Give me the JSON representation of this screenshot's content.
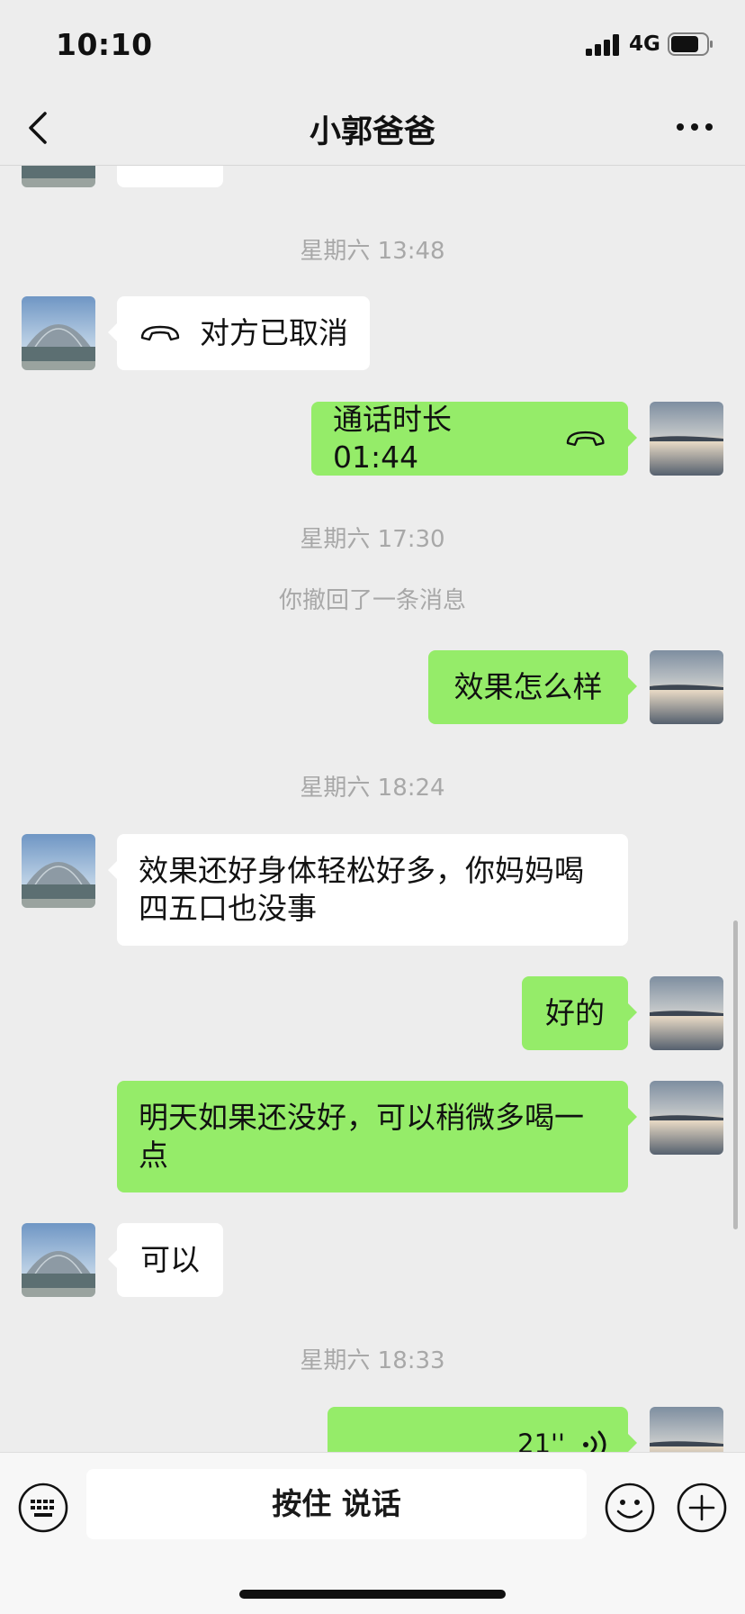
{
  "status_bar": {
    "time": "10:10",
    "network": "4G"
  },
  "header": {
    "title": "小郭爸爸"
  },
  "messages": [
    {
      "kind": "timestamp",
      "text": "星期六 13:48"
    },
    {
      "kind": "call",
      "side": "left",
      "text": "对方已取消"
    },
    {
      "kind": "call",
      "side": "right",
      "text": "通话时长 01:44"
    },
    {
      "kind": "timestamp",
      "text": "星期六 17:30"
    },
    {
      "kind": "system",
      "text": "你撤回了一条消息"
    },
    {
      "kind": "text",
      "side": "right",
      "text": "效果怎么样"
    },
    {
      "kind": "timestamp",
      "text": "星期六 18:24"
    },
    {
      "kind": "text",
      "side": "left",
      "lines": [
        "效果还好身体轻松好多，你妈妈喝",
        "四五口也没事"
      ]
    },
    {
      "kind": "text",
      "side": "right",
      "text": "好的"
    },
    {
      "kind": "text",
      "side": "right",
      "lines": [
        "明天如果还没好，可以稍微多喝一",
        "点"
      ]
    },
    {
      "kind": "text",
      "side": "left",
      "text": "可以"
    },
    {
      "kind": "timestamp",
      "text": "星期六 18:33"
    },
    {
      "kind": "voice",
      "side": "right",
      "duration": "21''"
    }
  ],
  "input_bar": {
    "hold_to_talk": "按住 说话"
  },
  "colors": {
    "background": "#ededed",
    "my_bubble": "#95ec69",
    "their_bubble": "#ffffff",
    "timestamp": "#a8a8a8"
  },
  "icons": [
    "back-chevron-icon",
    "more-dots-icon",
    "phone-hangup-icon",
    "voice-wave-icon",
    "keyboard-icon",
    "emoji-icon",
    "plus-icon"
  ]
}
